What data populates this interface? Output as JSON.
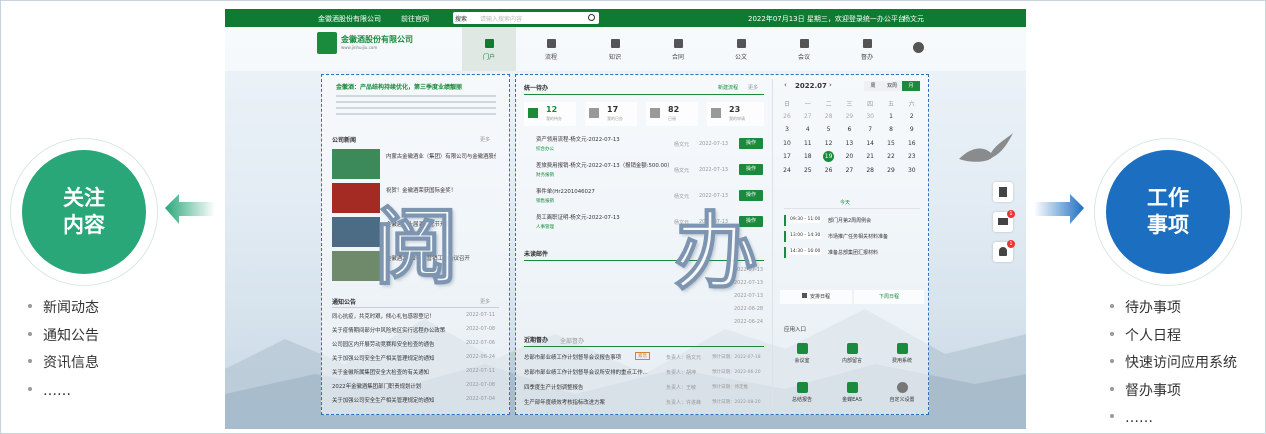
{
  "left": {
    "title_line1": "关注",
    "title_line2": "内容",
    "bullets": [
      "新闻动态",
      "通知公告",
      "资讯信息",
      "……"
    ]
  },
  "right": {
    "title_line1": "工作",
    "title_line2": "事项",
    "bullets": [
      "待办事项",
      "个人日程",
      "快速访问应用系统",
      "督办事项",
      "……"
    ]
  },
  "screenshot": {
    "topbar": {
      "company": "金徽酒股份有限公司",
      "official_site": "前往官网",
      "search_scope": "搜索",
      "search_placeholder": "请输入搜索内容",
      "welcome": "2022年07月13日 星期三，欢迎登录统一办公平台",
      "user": "杨文元"
    },
    "logo_text": "金徽酒股份有限公司",
    "logo_sub": "www.jinhuijiu.com",
    "nav": [
      "门户",
      "流程",
      "知识",
      "合同",
      "公文",
      "会议",
      "督办"
    ],
    "banner": "金徽酒：产品结构持续优化，第三季度业绩靓丽",
    "company_news": {
      "title": "公司新闻",
      "more": "更多",
      "items": [
        "内蒙古金徽酒业（集团）有限公司与金徽酒股份有限公司签约",
        "祝贺！金徽酒荣获国际金奖！",
        "金徽酒第十届酒文化节开幕",
        "金徽酒2022年度营销工作会议召开"
      ]
    },
    "notices": {
      "title": "通知公告",
      "more": "更多",
      "items": [
        {
          "text": "同心抗疫，共克时艰，倾心礼包感恩登记！",
          "date": "2022-07-11"
        },
        {
          "text": "关于疫情期间部分中风险地区实行远程办公政策",
          "date": "2022-07-08"
        },
        {
          "text": "公司园区内开展劳动竞赛和安全检查的通告",
          "date": "2022-07-06"
        },
        {
          "text": "关于加强公司安全生产相关管理规定的通知",
          "date": "2022-06-24"
        },
        {
          "text": "关于金徽所属集团安全大检查的有关通知",
          "date": "2022-07-11"
        },
        {
          "text": "2022年金徽酒集团部门职责规划计划",
          "date": "2022-07-08"
        },
        {
          "text": "关于加强公司安全生产相关管理规定的通知",
          "date": "2022-07-04"
        }
      ]
    },
    "todo": {
      "title": "统一待办",
      "new_flow": "新建流程",
      "more": "更多",
      "stats": [
        {
          "count": "12",
          "label": "我的待办"
        },
        {
          "count": "17",
          "label": "我的已办"
        },
        {
          "count": "82",
          "label": "已阅"
        },
        {
          "count": "23",
          "label": "我的申请"
        }
      ],
      "items": [
        {
          "title": "资产领用流程-杨文元-2022-07-13",
          "dept": "综合办公",
          "user": "杨文元",
          "date": "2022-07-13",
          "action": "操作"
        },
        {
          "title": "差旅费用报销-杨文元-2022-07-13（报销金额:500.00）",
          "dept": "财务报销",
          "user": "杨文元",
          "date": "2022-07-13",
          "action": "操作"
        },
        {
          "title": "事件单(Hr2201046027",
          "dept": "销售报销",
          "user": "杨文元",
          "date": "2022-07-13",
          "action": "操作"
        },
        {
          "title": "员工离职证明-杨文元-2022-07-13",
          "dept": "人事管理",
          "user": "杨文元",
          "date": "2022-07-13",
          "action": "操作"
        }
      ]
    },
    "mail": {
      "title": "未读邮件",
      "dates": [
        "2022-07-13",
        "2022-07-13",
        "2022-07-13",
        "2022-06-28",
        "2022-06-24"
      ]
    },
    "supervise": {
      "title": "近期督办",
      "tab2": "全部督办",
      "items": [
        {
          "text": "总部市部业绩工作计划督导会议报告事项",
          "tag": "紧急",
          "owner": "负责人：杨文元",
          "date": "预计日期：2022-07-18"
        },
        {
          "text": "总部市部业绩工作计划督导会议所安排的重点工作...",
          "tag": "",
          "owner": "负责人：胡坤",
          "date": "预计日期：2022-06-20"
        },
        {
          "text": "四季度生产计划调整报告",
          "tag": "",
          "owner": "负责人：王敏",
          "date": "预计日期：待定推"
        },
        {
          "text": "生产部年度绩效考核指标改进方案",
          "tag": "",
          "owner": "负责人：许进峰",
          "date": "预计日期：2022-08-20"
        }
      ]
    },
    "calendar": {
      "month": "2022.07",
      "views": [
        "周",
        "双周",
        "月"
      ],
      "weekdays": [
        "日",
        "一",
        "二",
        "三",
        "四",
        "五",
        "六"
      ],
      "days": [
        [
          "26",
          "27",
          "28",
          "29",
          "30",
          "1",
          "2"
        ],
        [
          "3",
          "4",
          "5",
          "6",
          "7",
          "8",
          "9"
        ],
        [
          "10",
          "11",
          "12",
          "13",
          "14",
          "15",
          "16"
        ],
        [
          "17",
          "18",
          "19",
          "20",
          "21",
          "22",
          "23"
        ],
        [
          "24",
          "25",
          "26",
          "27",
          "28",
          "29",
          "30"
        ]
      ],
      "today_label": "今天",
      "events": [
        {
          "time": "09:30 - 11:00",
          "title": "部门月第2周周例会"
        },
        {
          "time": "13:00 - 14:30",
          "title": "市场推广任务相关材料准备"
        },
        {
          "time": "14:30 - 16:00",
          "title": "准备总部集团汇报材料"
        }
      ],
      "add_schedule": "安排日程",
      "next_schedule": "下周日程"
    },
    "apps": {
      "title": "应用入口",
      "items": [
        "会议室",
        "内部留言",
        "费用系统",
        "总结报告",
        "金蝶EAS",
        "自定义设置"
      ]
    },
    "big_left": "阅",
    "big_right": "办",
    "side_badges": [
      "1",
      "1"
    ]
  }
}
